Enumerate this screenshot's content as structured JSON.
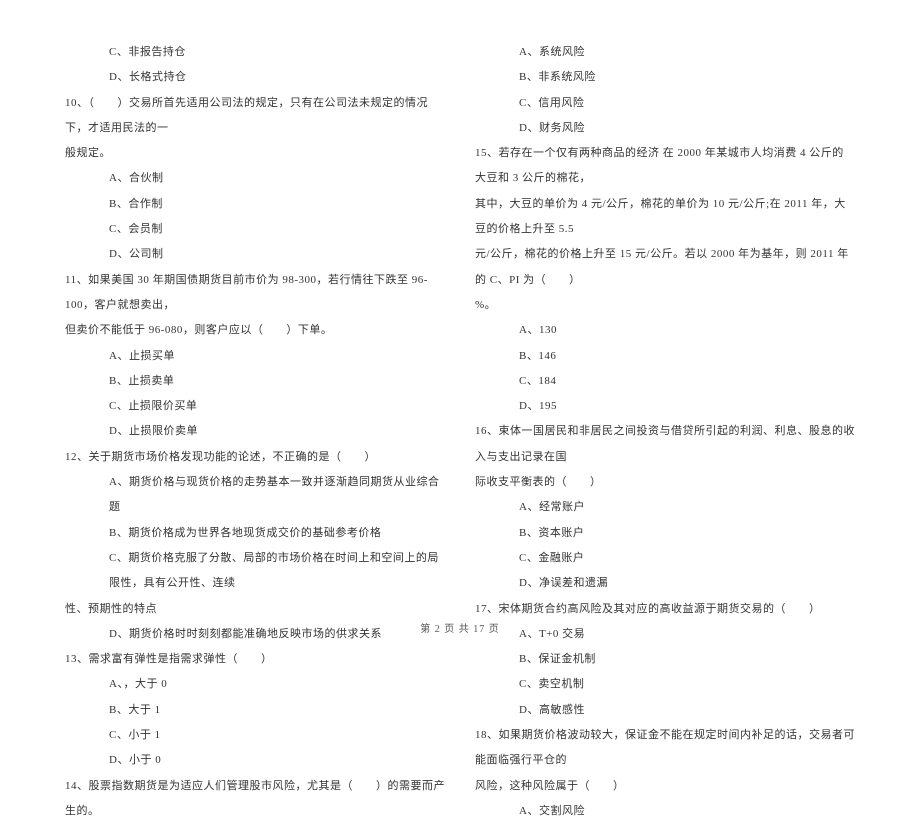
{
  "left_col": [
    {
      "cls": "indent-2",
      "t": "C、非报告持仓"
    },
    {
      "cls": "indent-2",
      "t": "D、长格式持仓"
    },
    {
      "cls": "",
      "t": "10、（　　）交易所首先适用公司法的规定，只有在公司法未规定的情况下，才适用民法的一"
    },
    {
      "cls": "",
      "t": "般规定。"
    },
    {
      "cls": "indent-2",
      "t": "A、合伙制"
    },
    {
      "cls": "indent-2",
      "t": "B、合作制"
    },
    {
      "cls": "indent-2",
      "t": "C、会员制"
    },
    {
      "cls": "indent-2",
      "t": "D、公司制"
    },
    {
      "cls": "",
      "t": "11、如果美国 30 年期国债期货目前市价为 98-300，若行情往下跌至 96-100，客户就想卖出，"
    },
    {
      "cls": "",
      "t": "但卖价不能低于 96-080，则客户应以（　　）下单。"
    },
    {
      "cls": "indent-2",
      "t": "A、止损买单"
    },
    {
      "cls": "indent-2",
      "t": "B、止损卖单"
    },
    {
      "cls": "indent-2",
      "t": "C、止损限价买单"
    },
    {
      "cls": "indent-2",
      "t": "D、止损限价卖单"
    },
    {
      "cls": "",
      "t": "12、关于期货市场价格发现功能的论述，不正确的是（　　）"
    },
    {
      "cls": "indent-2",
      "t": "A、期货价格与现货价格的走势基本一致并逐渐趋同期货从业综合题"
    },
    {
      "cls": "indent-2",
      "t": "B、期货价格成为世界各地现货成交价的基础参考价格"
    },
    {
      "cls": "indent-2",
      "t": "C、期货价格克服了分散、局部的市场价格在时间上和空间上的局限性，具有公开性、连续"
    },
    {
      "cls": "",
      "t": "性、预期性的特点"
    },
    {
      "cls": "indent-2",
      "t": "D、期货价格时时刻刻都能准确地反映市场的供求关系"
    },
    {
      "cls": "",
      "t": "13、需求富有弹性是指需求弹性（　　）"
    },
    {
      "cls": "indent-2",
      "t": "A、，大于 0"
    },
    {
      "cls": "indent-2",
      "t": "B、大于 1"
    },
    {
      "cls": "indent-2",
      "t": "C、小于 1"
    },
    {
      "cls": "indent-2",
      "t": "D、小于 0"
    },
    {
      "cls": "",
      "t": "14、股票指数期货是为适应人们管理股市风险，尤其是（　　）的需要而产生的。"
    }
  ],
  "right_col": [
    {
      "cls": "indent-2",
      "t": "A、系统风险"
    },
    {
      "cls": "indent-2",
      "t": "B、非系统风险"
    },
    {
      "cls": "indent-2",
      "t": "C、信用风险"
    },
    {
      "cls": "indent-2",
      "t": "D、财务风险"
    },
    {
      "cls": "",
      "t": "15、若存在一个仅有两种商品的经济 在 2000 年某城市人均消费 4 公斤的大豆和 3 公斤的棉花，"
    },
    {
      "cls": "",
      "t": "其中，大豆的单价为 4 元/公斤，棉花的单价为 10 元/公斤;在 2011 年，大豆的价格上升至 5.5"
    },
    {
      "cls": "",
      "t": "元/公斤，棉花的价格上升至 15 元/公斤。若以 2000 年为基年，则 2011 年的 C、PI 为（　　）"
    },
    {
      "cls": "",
      "t": "%。"
    },
    {
      "cls": "indent-2",
      "t": "A、130"
    },
    {
      "cls": "indent-2",
      "t": "B、146"
    },
    {
      "cls": "indent-2",
      "t": "C、184"
    },
    {
      "cls": "indent-2",
      "t": "D、195"
    },
    {
      "cls": "",
      "t": "16、束体一国居民和非居民之间投资与借贷所引起的利润、利息、股息的收入与支出记录在国"
    },
    {
      "cls": "",
      "t": "际收支平衡表的（　　）"
    },
    {
      "cls": "indent-2",
      "t": "A、经常账户"
    },
    {
      "cls": "indent-2",
      "t": "B、资本账户"
    },
    {
      "cls": "indent-2",
      "t": "C、金融账户"
    },
    {
      "cls": "indent-2",
      "t": "D、净误差和遗漏"
    },
    {
      "cls": "",
      "t": "17、宋体期货合约高风险及其对应的高收益源于期货交易的（　　）"
    },
    {
      "cls": "indent-2",
      "t": "A、T+0 交易"
    },
    {
      "cls": "indent-2",
      "t": "B、保证金机制"
    },
    {
      "cls": "indent-2",
      "t": "C、卖空机制"
    },
    {
      "cls": "indent-2",
      "t": "D、高敏感性"
    },
    {
      "cls": "",
      "t": "18、如果期货价格波动较大，保证金不能在规定时间内补足的话，交易者可能面临强行平仓的"
    },
    {
      "cls": "",
      "t": "风险，这种风险属于（　　）"
    },
    {
      "cls": "indent-2",
      "t": "A、交割风险"
    }
  ],
  "footer": "第 2 页 共 17 页"
}
